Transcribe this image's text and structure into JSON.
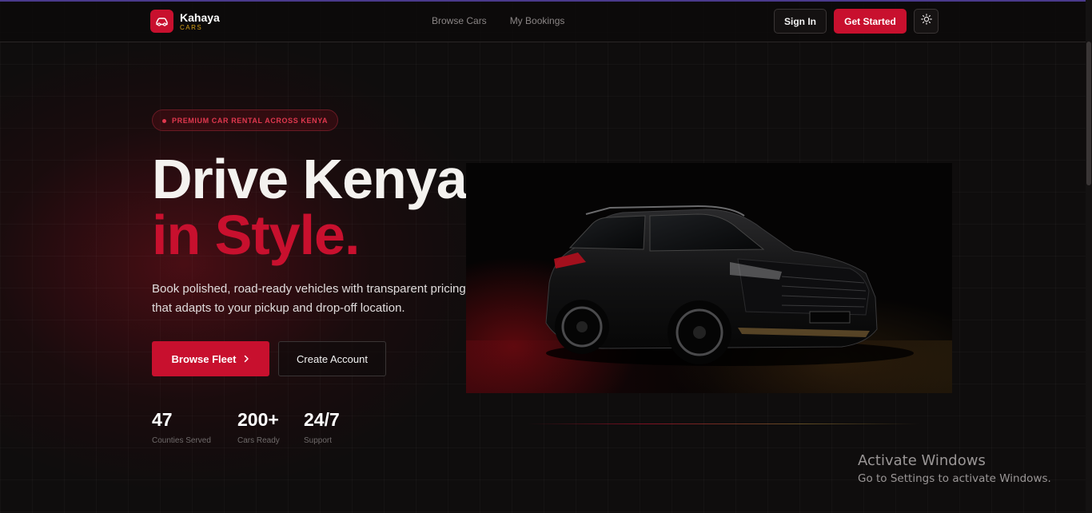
{
  "brand": {
    "name": "Kahaya",
    "sub": "CARS",
    "accent": "#c8102e"
  },
  "nav": {
    "items": [
      {
        "label": "Browse Cars"
      },
      {
        "label": "My Bookings"
      }
    ]
  },
  "header": {
    "sign_in": "Sign In",
    "get_started": "Get Started",
    "theme_icon": "sun-icon"
  },
  "hero": {
    "badge": "PREMIUM CAR RENTAL ACROSS KENYA",
    "title_line1": "Drive Kenya",
    "title_line2": "in Style.",
    "description": "Book polished, road-ready vehicles with transparent pricing that adapts to your pickup and drop-off location.",
    "primary_button": "Browse Fleet",
    "secondary_button": "Create Account"
  },
  "stats": [
    {
      "value": "47",
      "label": "Counties Served"
    },
    {
      "value": "200+",
      "label": "Cars Ready"
    },
    {
      "value": "24/7",
      "label": "Support"
    }
  ],
  "watermark": {
    "title": "Activate Windows",
    "subtitle": "Go to Settings to activate Windows."
  }
}
